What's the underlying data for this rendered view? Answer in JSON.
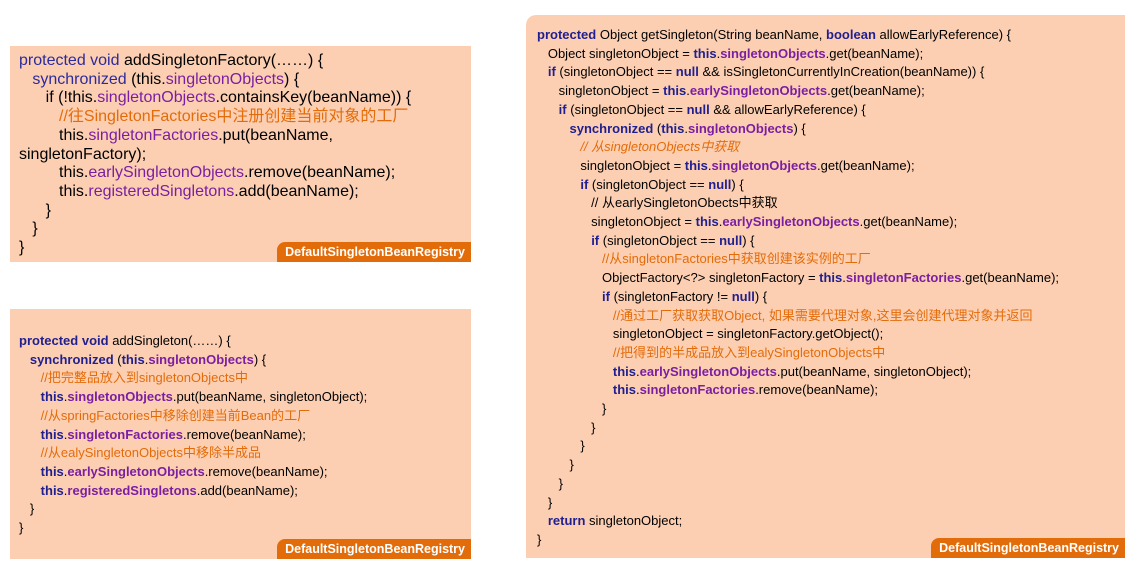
{
  "panels": [
    {
      "tag": "DefaultSingletonBeanRegistry",
      "lines": [
        [
          {
            "t": "kw",
            "v": "protected void"
          },
          {
            "t": "n",
            "v": " addSingletonFactory(……) {"
          }
        ],
        [
          {
            "t": "n",
            "v": "   "
          },
          {
            "t": "kw",
            "v": "synchronized"
          },
          {
            "t": "n",
            "v": " (this."
          },
          {
            "t": "fld",
            "v": "singletonObjects"
          },
          {
            "t": "n",
            "v": ") {"
          }
        ],
        [
          {
            "t": "n",
            "v": "      if (!this."
          },
          {
            "t": "fld",
            "v": "singletonObjects"
          },
          {
            "t": "n",
            "v": ".containsKey(beanName)) {"
          }
        ],
        [
          {
            "t": "n",
            "v": "         "
          },
          {
            "t": "cm",
            "v": "//往SingletonFactories中注册创建当前对象的工厂"
          }
        ],
        [
          {
            "t": "n",
            "v": "         this."
          },
          {
            "t": "fld",
            "v": "singletonFactories"
          },
          {
            "t": "n",
            "v": ".put(beanName,"
          }
        ],
        [
          {
            "t": "n",
            "v": "singletonFactory);"
          }
        ],
        [
          {
            "t": "n",
            "v": "         this."
          },
          {
            "t": "fld",
            "v": "earlySingletonObjects"
          },
          {
            "t": "n",
            "v": ".remove(beanName);"
          }
        ],
        [
          {
            "t": "n",
            "v": "         this."
          },
          {
            "t": "fld",
            "v": "registeredSingletons"
          },
          {
            "t": "n",
            "v": ".add(beanName);"
          }
        ],
        [
          {
            "t": "n",
            "v": "      }"
          }
        ],
        [
          {
            "t": "n",
            "v": "   }"
          }
        ],
        [
          {
            "t": "n",
            "v": "}"
          }
        ]
      ]
    },
    {
      "tag": "DefaultSingletonBeanRegistry",
      "lines": [
        [
          {
            "t": "kw",
            "v": "protected void"
          },
          {
            "t": "n",
            "v": " addSingleton(……) {"
          }
        ],
        [
          {
            "t": "n",
            "v": "   "
          },
          {
            "t": "kw",
            "v": "synchronized"
          },
          {
            "t": "n",
            "v": " ("
          },
          {
            "t": "kw",
            "v": "this"
          },
          {
            "t": "n",
            "v": "."
          },
          {
            "t": "fld",
            "v": "singletonObjects"
          },
          {
            "t": "n",
            "v": ") {"
          }
        ],
        [
          {
            "t": "n",
            "v": "      "
          },
          {
            "t": "cm",
            "v": "//把完整品放入到singletonObjects中"
          }
        ],
        [
          {
            "t": "n",
            "v": "      "
          },
          {
            "t": "kw",
            "v": "this"
          },
          {
            "t": "n",
            "v": "."
          },
          {
            "t": "fld",
            "v": "singletonObjects"
          },
          {
            "t": "n",
            "v": ".put(beanName, singletonObject);"
          }
        ],
        [
          {
            "t": "n",
            "v": "      "
          },
          {
            "t": "cm",
            "v": "//从springFactories中移除创建当前Bean的工厂"
          }
        ],
        [
          {
            "t": "n",
            "v": "      "
          },
          {
            "t": "kw",
            "v": "this"
          },
          {
            "t": "n",
            "v": "."
          },
          {
            "t": "fld",
            "v": "singletonFactories"
          },
          {
            "t": "n",
            "v": ".remove(beanName);"
          }
        ],
        [
          {
            "t": "n",
            "v": "      "
          },
          {
            "t": "cm",
            "v": "//从ealySingletonObjects中移除半成品"
          }
        ],
        [
          {
            "t": "n",
            "v": "      "
          },
          {
            "t": "kw",
            "v": "this"
          },
          {
            "t": "n",
            "v": "."
          },
          {
            "t": "fld",
            "v": "earlySingletonObjects"
          },
          {
            "t": "n",
            "v": ".remove(beanName);"
          }
        ],
        [
          {
            "t": "n",
            "v": "      "
          },
          {
            "t": "kw",
            "v": "this"
          },
          {
            "t": "n",
            "v": "."
          },
          {
            "t": "fld",
            "v": "registeredSingletons"
          },
          {
            "t": "n",
            "v": ".add(beanName);"
          }
        ],
        [
          {
            "t": "n",
            "v": "   }"
          }
        ],
        [
          {
            "t": "n",
            "v": "}"
          }
        ]
      ]
    },
    {
      "tag": "DefaultSingletonBeanRegistry",
      "lines": [
        [
          {
            "t": "kw",
            "v": "protected"
          },
          {
            "t": "n",
            "v": " Object getSingleton(String beanName, "
          },
          {
            "t": "kw",
            "v": "boolean"
          },
          {
            "t": "n",
            "v": " allowEarlyReference) {"
          }
        ],
        [
          {
            "t": "n",
            "v": "   Object singletonObject = "
          },
          {
            "t": "kw",
            "v": "this"
          },
          {
            "t": "n",
            "v": "."
          },
          {
            "t": "fld",
            "v": "singletonObjects"
          },
          {
            "t": "n",
            "v": ".get(beanName);"
          }
        ],
        [
          {
            "t": "n",
            "v": "   "
          },
          {
            "t": "kw",
            "v": "if"
          },
          {
            "t": "n",
            "v": " (singletonObject == "
          },
          {
            "t": "kw",
            "v": "null"
          },
          {
            "t": "n",
            "v": " && isSingletonCurrentlyInCreation(beanName)) {"
          }
        ],
        [
          {
            "t": "n",
            "v": "      singletonObject = "
          },
          {
            "t": "kw",
            "v": "this"
          },
          {
            "t": "n",
            "v": "."
          },
          {
            "t": "fld",
            "v": "earlySingletonObjects"
          },
          {
            "t": "n",
            "v": ".get(beanName);"
          }
        ],
        [
          {
            "t": "n",
            "v": "      "
          },
          {
            "t": "kw",
            "v": "if"
          },
          {
            "t": "n",
            "v": " (singletonObject == "
          },
          {
            "t": "kw",
            "v": "null"
          },
          {
            "t": "n",
            "v": " && allowEarlyReference) {"
          }
        ],
        [
          {
            "t": "n",
            "v": "         "
          },
          {
            "t": "kw",
            "v": "synchronized"
          },
          {
            "t": "n",
            "v": " ("
          },
          {
            "t": "kw",
            "v": "this"
          },
          {
            "t": "n",
            "v": "."
          },
          {
            "t": "fld",
            "v": "singletonObjects"
          },
          {
            "t": "n",
            "v": ") {"
          }
        ],
        [
          {
            "t": "n",
            "v": "            "
          },
          {
            "t": "cm it",
            "v": "// 从singletonObjects中获取"
          }
        ],
        [
          {
            "t": "n",
            "v": "            singletonObject = "
          },
          {
            "t": "kw",
            "v": "this"
          },
          {
            "t": "n",
            "v": "."
          },
          {
            "t": "fld",
            "v": "singletonObjects"
          },
          {
            "t": "n",
            "v": ".get(beanName);"
          }
        ],
        [
          {
            "t": "n",
            "v": "            "
          },
          {
            "t": "kw",
            "v": "if"
          },
          {
            "t": "n",
            "v": " (singletonObject == "
          },
          {
            "t": "kw",
            "v": "null"
          },
          {
            "t": "n",
            "v": ") {"
          }
        ],
        [
          {
            "t": "n",
            "v": "               // 从earlySingletonObects中获取"
          }
        ],
        [
          {
            "t": "n",
            "v": "               singletonObject = "
          },
          {
            "t": "kw",
            "v": "this"
          },
          {
            "t": "n",
            "v": "."
          },
          {
            "t": "fld",
            "v": "earlySingletonObjects"
          },
          {
            "t": "n",
            "v": ".get(beanName);"
          }
        ],
        [
          {
            "t": "n",
            "v": "               "
          },
          {
            "t": "kw",
            "v": "if"
          },
          {
            "t": "n",
            "v": " (singletonObject == "
          },
          {
            "t": "kw",
            "v": "null"
          },
          {
            "t": "n",
            "v": ") {"
          }
        ],
        [
          {
            "t": "n",
            "v": "                  "
          },
          {
            "t": "cm",
            "v": "//从singletonFactories中获取创建该实例的工厂"
          }
        ],
        [
          {
            "t": "n",
            "v": "                  ObjectFactory<?> singletonFactory = "
          },
          {
            "t": "kw",
            "v": "this"
          },
          {
            "t": "n",
            "v": "."
          },
          {
            "t": "fld",
            "v": "singletonFactories"
          },
          {
            "t": "n",
            "v": ".get(beanName);"
          }
        ],
        [
          {
            "t": "n",
            "v": "                  "
          },
          {
            "t": "kw",
            "v": "if"
          },
          {
            "t": "n",
            "v": " (singletonFactory != "
          },
          {
            "t": "kw",
            "v": "null"
          },
          {
            "t": "n",
            "v": ") {"
          }
        ],
        [
          {
            "t": "n",
            "v": "                     "
          },
          {
            "t": "cm",
            "v": "//通过工厂获取获取Object, 如果需要代理对象,这里会创建代理对象并返回"
          }
        ],
        [
          {
            "t": "n",
            "v": "                     singletonObject = singletonFactory.getObject();"
          }
        ],
        [
          {
            "t": "n",
            "v": "                     "
          },
          {
            "t": "cm",
            "v": "//把得到的半成品放入到ealySingletonObjects中"
          }
        ],
        [
          {
            "t": "n",
            "v": "                     "
          },
          {
            "t": "kw",
            "v": "this"
          },
          {
            "t": "n",
            "v": "."
          },
          {
            "t": "fld",
            "v": "earlySingletonObjects"
          },
          {
            "t": "n",
            "v": ".put(beanName, singletonObject);"
          }
        ],
        [
          {
            "t": "n",
            "v": "                     "
          },
          {
            "t": "kw",
            "v": "this"
          },
          {
            "t": "n",
            "v": "."
          },
          {
            "t": "fld",
            "v": "singletonFactories"
          },
          {
            "t": "n",
            "v": ".remove(beanName);"
          }
        ],
        [
          {
            "t": "n",
            "v": "                  }"
          }
        ],
        [
          {
            "t": "n",
            "v": "               }"
          }
        ],
        [
          {
            "t": "n",
            "v": "            }"
          }
        ],
        [
          {
            "t": "n",
            "v": "         }"
          }
        ],
        [
          {
            "t": "n",
            "v": "      }"
          }
        ],
        [
          {
            "t": "n",
            "v": "   }"
          }
        ],
        [
          {
            "t": "n",
            "v": "   "
          },
          {
            "t": "kw",
            "v": "return"
          },
          {
            "t": "n",
            "v": " singletonObject;"
          }
        ],
        [
          {
            "t": "n",
            "v": "}"
          }
        ]
      ]
    }
  ]
}
